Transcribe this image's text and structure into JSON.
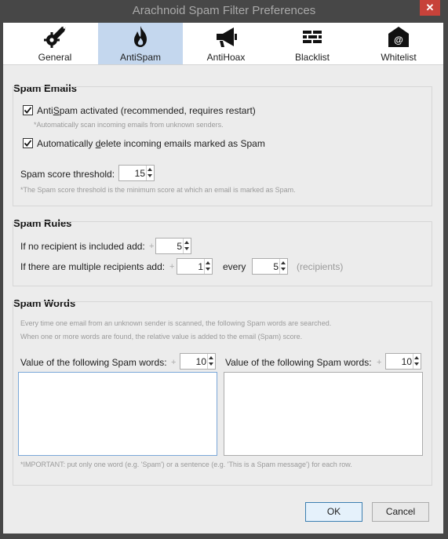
{
  "window": {
    "title": "Arachnoid Spam Filter Preferences",
    "close_glyph": "✕"
  },
  "tabs": [
    {
      "label": "General",
      "icon": "gear-wrench-icon",
      "active": false
    },
    {
      "label": "AntiSpam",
      "icon": "flame-icon",
      "active": true
    },
    {
      "label": "AntiHoax",
      "icon": "megaphone-icon",
      "active": false
    },
    {
      "label": "Blacklist",
      "icon": "brick-wall-icon",
      "active": false
    },
    {
      "label": "Whitelist",
      "icon": "envelope-at-icon",
      "active": false
    }
  ],
  "spam_emails": {
    "title": "Spam Emails",
    "antispam": {
      "label_pre": "Anti",
      "label_underline": "S",
      "label_post": "pam activated (recommended, requires restart)",
      "checked": true,
      "hint": "*Automatically scan incoming emails from unknown senders."
    },
    "auto_delete": {
      "label_pre": "Automatically ",
      "label_underline": "d",
      "label_post": "elete incoming emails marked as Spam",
      "checked": true
    },
    "threshold": {
      "label": "Spam score threshold:",
      "value": "15",
      "hint": "*The Spam score threshold is the minimum score at which an email is marked as Spam."
    }
  },
  "spam_rules": {
    "title": "Spam Rules",
    "no_recipient": {
      "label": "If no recipient is included add:",
      "plus": "+",
      "value": "5"
    },
    "multiple": {
      "label": "If there are multiple recipients add:",
      "plus": "+",
      "value": "1",
      "every_label": "every",
      "every_value": "5",
      "unit": "(recipients)"
    }
  },
  "spam_words": {
    "title": "Spam Words",
    "desc1": "Every time one email from an unknown sender is scanned, the following Spam words are searched.",
    "desc2": "When one or more words are found, the relative value is added to the email (Spam) score.",
    "left": {
      "label": "Value of the following Spam words:",
      "plus": "+",
      "value": "10",
      "text": ""
    },
    "right": {
      "label": "Value of the following Spam words:",
      "plus": "+",
      "value": "10",
      "text": ""
    },
    "note": "*IMPORTANT: put only one word (e.g. 'Spam') or a sentence (e.g. 'This is a Spam message') for each row."
  },
  "buttons": {
    "ok": "OK",
    "cancel": "Cancel"
  },
  "colors": {
    "active_tab": "#c4d7ee",
    "close": "#c7423a",
    "focus_border": "#7aa7d8",
    "ok_border": "#3c7fb1"
  }
}
